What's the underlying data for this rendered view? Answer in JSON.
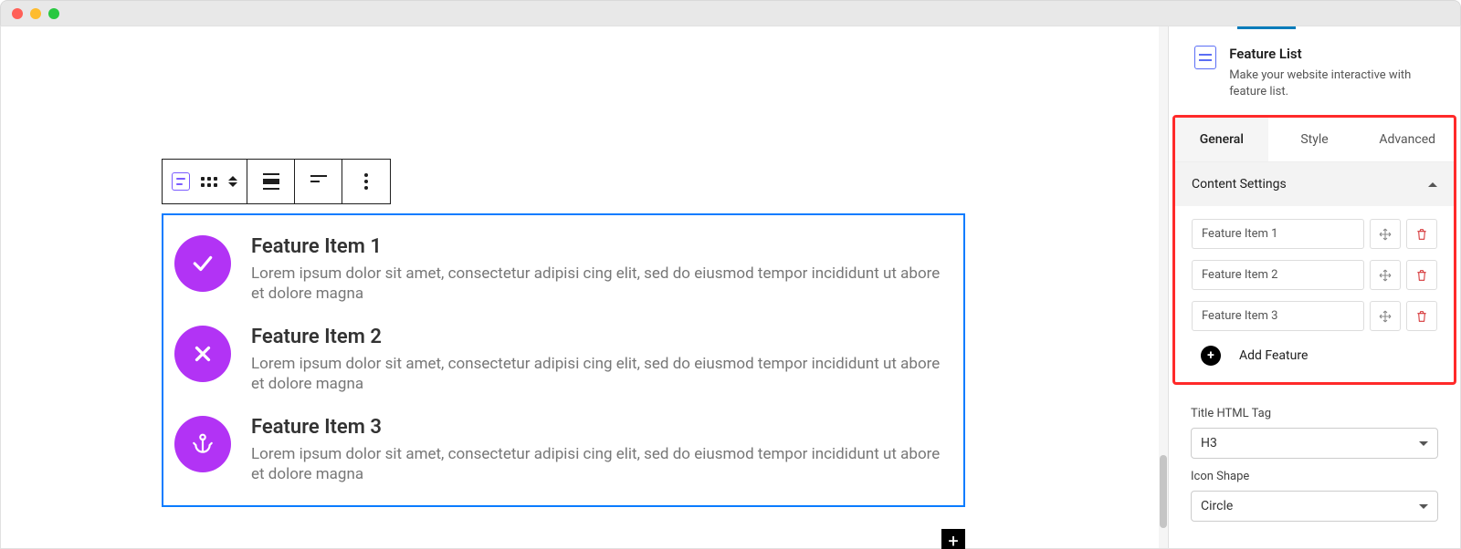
{
  "toolbar": {
    "block_type_label": "Feature List"
  },
  "features": [
    {
      "title": "Feature Item 1",
      "desc": "Lorem ipsum dolor sit amet, consectetur adipisi cing elit, sed do eiusmod tempor incididunt ut abore et dolore magna",
      "icon": "check"
    },
    {
      "title": "Feature Item 2",
      "desc": "Lorem ipsum dolor sit amet, consectetur adipisi cing elit, sed do eiusmod tempor incididunt ut abore et dolore magna",
      "icon": "times"
    },
    {
      "title": "Feature Item 3",
      "desc": "Lorem ipsum dolor sit amet, consectetur adipisi cing elit, sed do eiusmod tempor incididunt ut abore et dolore magna",
      "icon": "anchor"
    }
  ],
  "sidebar": {
    "block_name": "Feature List",
    "block_desc": "Make your website interactive with feature list.",
    "tabs": {
      "general": "General",
      "style": "Style",
      "advanced": "Advanced"
    },
    "section_title": "Content Settings",
    "repeater": [
      {
        "label": "Feature Item 1"
      },
      {
        "label": "Feature Item 2"
      },
      {
        "label": "Feature Item 3"
      }
    ],
    "add_feature_label": "Add Feature",
    "title_tag_label": "Title HTML Tag",
    "title_tag_value": "H3",
    "icon_shape_label": "Icon Shape",
    "icon_shape_value": "Circle"
  },
  "colors": {
    "accent": "#b233f5",
    "selection": "#0a7cff",
    "highlight": "#ff2a2a"
  }
}
